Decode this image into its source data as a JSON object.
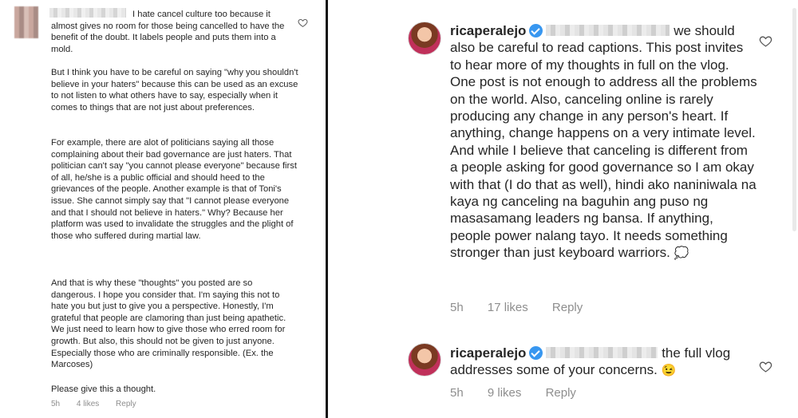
{
  "left_comment": {
    "paragraphs": [
      "I hate cancel culture too because it almost gives no room for those being cancelled to have the benefit of the doubt. It labels people and puts them into a mold.",
      "But I think you have to be careful on saying \"why you shouldn't believe in your haters\" because this can be used as an excuse to not listen to what others have to say, especially when it comes to things that are not just about preferences.",
      "For example, there are alot of politicians saying all those complaining about their bad governance are just haters. That politician can't say \"you cannot please everyone\" because first of all, he/she is a public official and should heed to the grievances of the people. Another example is that of Toni's issue. She cannot simply say that \"I cannot please everyone and that I should not believe in haters.\" Why? Because her platform was used to invalidate the struggles and the plight of those who suffered during martial law.",
      "And that is why these \"thoughts\" you posted are so dangerous. I hope you consider that. I'm saying this not to hate you but just to give you a perspective. Honestly, I'm grateful that people are clamoring than just being apathetic. We just need to learn how to give those who erred room for growth. But also, this should not be given to just anyone. Especially those who are criminally responsible. (Ex. the Marcoses)",
      "Please give this a thought."
    ],
    "time": "5h",
    "likes": "4 likes",
    "reply": "Reply"
  },
  "reply1": {
    "username": "ricaperalejo",
    "text": "we should also be careful to read captions. This post invites to hear more of my thoughts in full on the vlog. One post is not enough to address all the problems on the world. Also, canceling online is rarely producing any change in any person's heart. If anything, change happens on a very intimate level. And while I believe that canceling is different from a people asking for good governance so I am okay with that (I do that as well), hindi ako naniniwala na kaya ng canceling na baguhin ang puso ng masasamang leaders ng bansa. If anything, people power nalang tayo. It needs something stronger than just keyboard warriors.",
    "emoji": "💭",
    "time": "5h",
    "likes": "17 likes",
    "reply": "Reply"
  },
  "reply2": {
    "username": "ricaperalejo",
    "text": "the full vlog addresses some of your concerns.",
    "emoji": "😉",
    "time": "5h",
    "likes": "9 likes",
    "reply": "Reply"
  },
  "colors": {
    "verified": "#3897f0",
    "meta": "#8e8e8e",
    "text": "#262626"
  }
}
